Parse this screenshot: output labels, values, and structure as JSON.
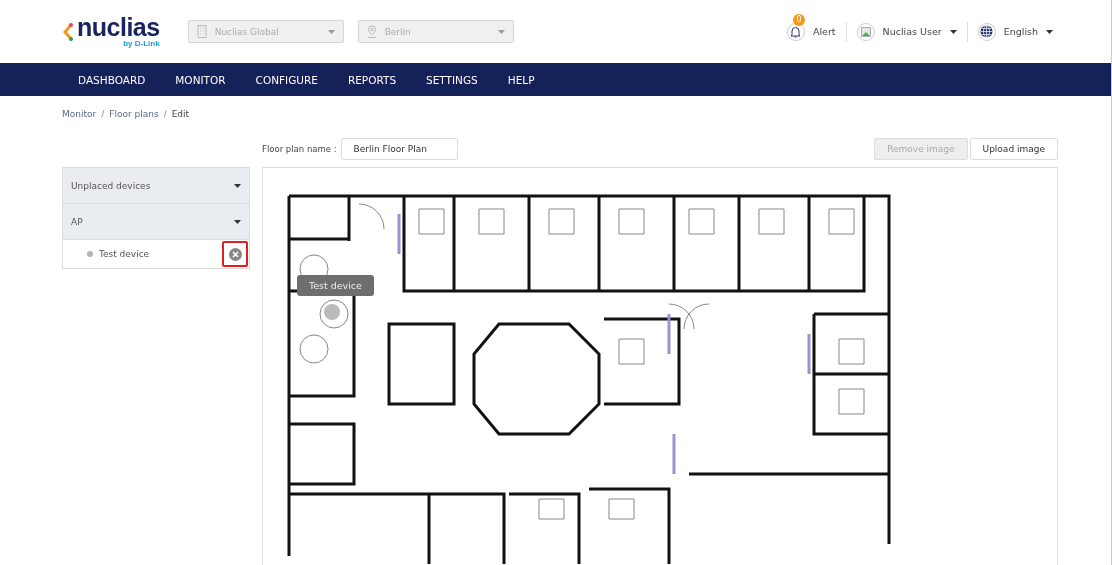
{
  "logo": {
    "word": "nuclias",
    "tagline": "by D-Link"
  },
  "selectors": [
    {
      "kind": "building",
      "value": "Nuclias Global"
    },
    {
      "kind": "pin",
      "value": "Berlin"
    }
  ],
  "header": {
    "alert": {
      "label": "Alert",
      "count": "0"
    },
    "user": "Nuclias User",
    "language": "English"
  },
  "nav": [
    "DASHBOARD",
    "MONITOR",
    "CONFIGURE",
    "REPORTS",
    "SETTINGS",
    "HELP"
  ],
  "breadcrumb": [
    {
      "kind": "link",
      "text": "Monitor"
    },
    {
      "kind": "separator",
      "text": "/"
    },
    {
      "kind": "link",
      "text": "Floor plans"
    },
    {
      "kind": "separator",
      "text": "/"
    },
    {
      "kind": "current",
      "text": "Edit"
    }
  ],
  "floor_plan_name": {
    "label": "Floor plan name :",
    "value": "Berlin Floor Plan"
  },
  "buttons": [
    {
      "label": "Remove image",
      "disabled": true
    },
    {
      "label": "Upload image",
      "disabled": false
    }
  ],
  "device_panel": {
    "sections": [
      "Unplaced devices",
      "AP"
    ],
    "devices": [
      {
        "name": "Test device",
        "color": "#b5b5b5",
        "focused": true
      }
    ]
  },
  "placed_device": {
    "tooltip": "Test device"
  }
}
